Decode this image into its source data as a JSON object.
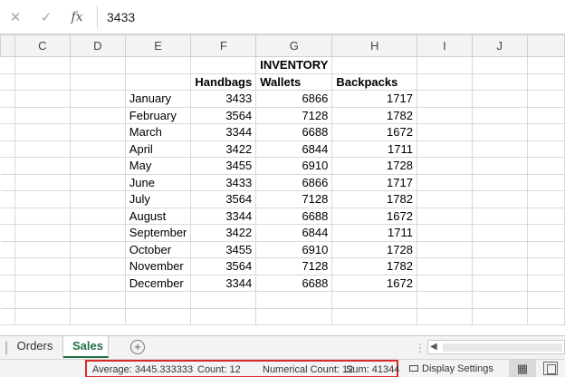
{
  "formula_bar": {
    "cancel_icon": "close-icon",
    "enter_icon": "check-icon",
    "function_label": "fx",
    "value": "3433"
  },
  "columns": [
    "C",
    "D",
    "E",
    "F",
    "G",
    "H",
    "I",
    "J"
  ],
  "sheet": {
    "title": "INVENTORY",
    "headers": [
      "Handbags",
      "Wallets",
      "Backpacks"
    ],
    "rows": [
      {
        "month": "January",
        "handbags": "3433",
        "wallets": "6866",
        "backpacks": "1717"
      },
      {
        "month": "February",
        "handbags": "3564",
        "wallets": "7128",
        "backpacks": "1782"
      },
      {
        "month": "March",
        "handbags": "3344",
        "wallets": "6688",
        "backpacks": "1672"
      },
      {
        "month": "April",
        "handbags": "3422",
        "wallets": "6844",
        "backpacks": "1711"
      },
      {
        "month": "May",
        "handbags": "3455",
        "wallets": "6910",
        "backpacks": "1728"
      },
      {
        "month": "June",
        "handbags": "3433",
        "wallets": "6866",
        "backpacks": "1717"
      },
      {
        "month": "July",
        "handbags": "3564",
        "wallets": "7128",
        "backpacks": "1782"
      },
      {
        "month": "August",
        "handbags": "3344",
        "wallets": "6688",
        "backpacks": "1672"
      },
      {
        "month": "September",
        "handbags": "3422",
        "wallets": "6844",
        "backpacks": "1711"
      },
      {
        "month": "October",
        "handbags": "3455",
        "wallets": "6910",
        "backpacks": "1728"
      },
      {
        "month": "November",
        "handbags": "3564",
        "wallets": "7128",
        "backpacks": "1782"
      },
      {
        "month": "December",
        "handbags": "3344",
        "wallets": "6688",
        "backpacks": "1672"
      }
    ]
  },
  "tabs": [
    {
      "label": "Orders",
      "active": false
    },
    {
      "label": "Sales",
      "active": true
    }
  ],
  "add_sheet_label": "+",
  "scroll_dots": "⋮",
  "status_bar": {
    "average": "Average: 3445.333333",
    "count": "Count: 12",
    "numerical_count": "Numerical Count: 12",
    "sum": "Sum: 41344",
    "display_settings": "Display Settings"
  },
  "colors": {
    "accent": "#1e7145",
    "highlight_box": "#d92b2b",
    "header_bg": "#f3f3f3",
    "grid_line": "#d9d9d9"
  }
}
